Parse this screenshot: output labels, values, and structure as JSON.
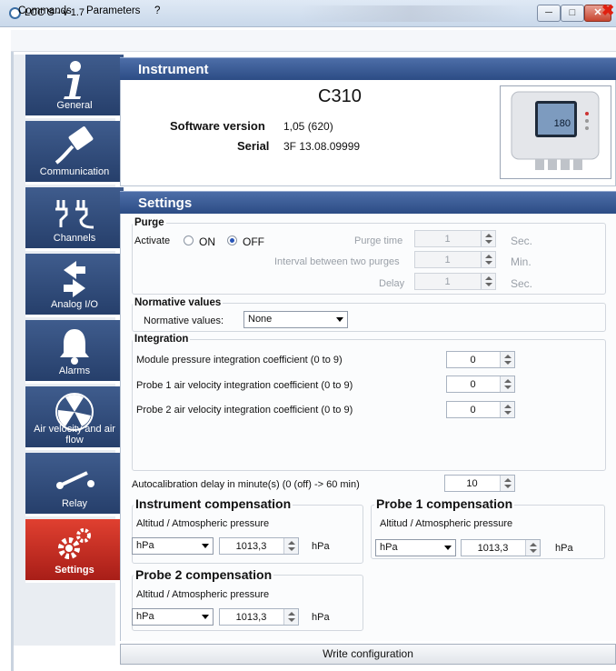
{
  "window": {
    "title": "LCC S - v 1.7"
  },
  "menu": {
    "commands": "Commands",
    "parameters": "Parameters",
    "help": "?"
  },
  "sidebar": {
    "items": [
      {
        "label": "General",
        "icon": "info-icon"
      },
      {
        "label": "Communication",
        "icon": "network-cable-icon"
      },
      {
        "label": "Channels",
        "icon": "plug-icon"
      },
      {
        "label": "Analog I/O",
        "icon": "arrows-icon"
      },
      {
        "label": "Alarms",
        "icon": "bell-icon"
      },
      {
        "label": "Air velocity and air flow",
        "icon": "fan-icon"
      },
      {
        "label": "Relay",
        "icon": "relay-switch-icon"
      },
      {
        "label": "Settings",
        "icon": "gears-icon",
        "active": true
      }
    ]
  },
  "instrument": {
    "header": "Instrument",
    "model": "C310",
    "software_version_label": "Software version",
    "software_version": "1,05 (620)",
    "serial_label": "Serial",
    "serial": "3F 13.08.09999",
    "device_display_value": "180"
  },
  "settings": {
    "header": "Settings",
    "purge": {
      "title": "Purge",
      "activate_label": "Activate",
      "on_label": "ON",
      "off_label": "OFF",
      "selected": "OFF",
      "purge_time_label": "Purge time",
      "purge_time": "1",
      "purge_time_unit": "Sec.",
      "interval_label": "Interval between two purges",
      "interval": "1",
      "interval_unit": "Min.",
      "delay_label": "Delay",
      "delay": "1",
      "delay_unit": "Sec."
    },
    "normative": {
      "title": "Normative values",
      "label": "Normative values:",
      "value": "None"
    },
    "integration": {
      "title": "Integration",
      "rows": [
        {
          "label": "Module pressure integration coefficient (0 to 9)",
          "value": "0"
        },
        {
          "label": "Probe 1 air velocity integration coefficient (0 to 9)",
          "value": "0"
        },
        {
          "label": "Probe 2 air velocity integration coefficient (0 to 9)",
          "value": "0"
        }
      ]
    },
    "autocalibration": {
      "label": "Autocalibration delay in minute(s) (0 (off) -> 60 min)",
      "value": "10"
    },
    "instrument_comp": {
      "title": "Instrument compensation",
      "subtitle": "Altitud / Atmospheric pressure",
      "unit_select": "hPa",
      "value": "1013,3",
      "unit": "hPa"
    },
    "probe1_comp": {
      "title": "Probe 1 compensation",
      "subtitle": "Altitud / Atmospheric pressure",
      "unit_select": "hPa",
      "value": "1013,3",
      "unit": "hPa"
    },
    "probe2_comp": {
      "title": "Probe 2 compensation",
      "subtitle": "Altitud / Atmospheric pressure",
      "unit_select": "hPa",
      "value": "1013,3",
      "unit": "hPa"
    }
  },
  "footer": {
    "write_button": "Write configuration"
  }
}
